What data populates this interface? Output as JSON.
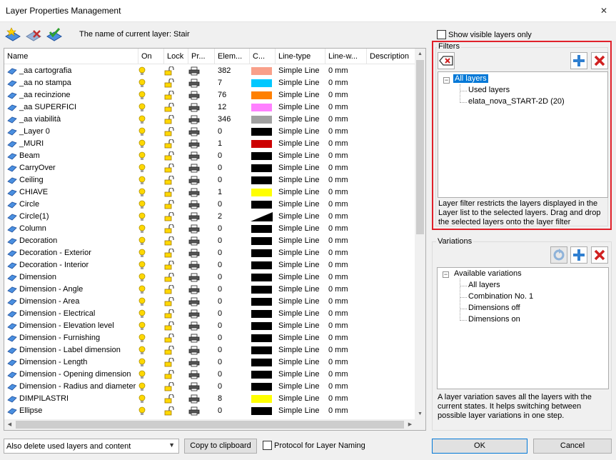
{
  "window": {
    "title": "Layer Properties Management",
    "close_label": "✕"
  },
  "current_layer_text": "The name of current layer: Stair",
  "show_visible_label": "Show visible layers only",
  "columns": [
    "Name",
    "On",
    "Lock",
    "Pr...",
    "Elem...",
    "C...",
    "Line-type",
    "Line-w...",
    "Description"
  ],
  "layers": [
    {
      "name": "_aa cartografia",
      "elements": "382",
      "color": "#f9a08a",
      "linetype": "Simple Line",
      "lineweight": "0 mm"
    },
    {
      "name": "_aa no stampa",
      "elements": "7",
      "color": "#00c8ff",
      "linetype": "Simple Line",
      "lineweight": "0 mm"
    },
    {
      "name": "_aa recinzione",
      "elements": "76",
      "color": "#ff8000",
      "linetype": "Simple Line",
      "lineweight": "0 mm"
    },
    {
      "name": "_aa SUPERFICI",
      "elements": "12",
      "color": "#ff80ff",
      "linetype": "Simple Line",
      "lineweight": "0 mm"
    },
    {
      "name": "_aa viabilità",
      "elements": "346",
      "color": "#a0a0a0",
      "linetype": "Simple Line",
      "lineweight": "0 mm"
    },
    {
      "name": "_Layer 0",
      "elements": "0",
      "color": "#000000",
      "linetype": "Simple Line",
      "lineweight": "0 mm"
    },
    {
      "name": "_MURI",
      "elements": "1",
      "color": "#cc0000",
      "linetype": "Simple Line",
      "lineweight": "0 mm"
    },
    {
      "name": "Beam",
      "elements": "0",
      "color": "#000000",
      "linetype": "Simple Line",
      "lineweight": "0 mm"
    },
    {
      "name": "CarryOver",
      "elements": "0",
      "color": "#000000",
      "linetype": "Simple Line",
      "lineweight": "0 mm"
    },
    {
      "name": "Ceiling",
      "elements": "0",
      "color": "#000000",
      "linetype": "Simple Line",
      "lineweight": "0 mm"
    },
    {
      "name": "CHIAVE",
      "elements": "1",
      "color": "#ffff00",
      "linetype": "Simple Line",
      "lineweight": "0 mm"
    },
    {
      "name": "Circle",
      "elements": "0",
      "color": "#000000",
      "linetype": "Simple Line",
      "lineweight": "0 mm"
    },
    {
      "name": "Circle(1)",
      "elements": "2",
      "color": "diag",
      "linetype": "Simple Line",
      "lineweight": "0 mm"
    },
    {
      "name": "Column",
      "elements": "0",
      "color": "#000000",
      "linetype": "Simple Line",
      "lineweight": "0 mm"
    },
    {
      "name": "Decoration",
      "elements": "0",
      "color": "#000000",
      "linetype": "Simple Line",
      "lineweight": "0 mm"
    },
    {
      "name": "Decoration - Exterior",
      "elements": "0",
      "color": "#000000",
      "linetype": "Simple Line",
      "lineweight": "0 mm"
    },
    {
      "name": "Decoration - Interior",
      "elements": "0",
      "color": "#000000",
      "linetype": "Simple Line",
      "lineweight": "0 mm"
    },
    {
      "name": "Dimension",
      "elements": "0",
      "color": "#000000",
      "linetype": "Simple Line",
      "lineweight": "0 mm"
    },
    {
      "name": "Dimension - Angle",
      "elements": "0",
      "color": "#000000",
      "linetype": "Simple Line",
      "lineweight": "0 mm"
    },
    {
      "name": "Dimension - Area",
      "elements": "0",
      "color": "#000000",
      "linetype": "Simple Line",
      "lineweight": "0 mm"
    },
    {
      "name": "Dimension - Electrical",
      "elements": "0",
      "color": "#000000",
      "linetype": "Simple Line",
      "lineweight": "0 mm"
    },
    {
      "name": "Dimension - Elevation level",
      "elements": "0",
      "color": "#000000",
      "linetype": "Simple Line",
      "lineweight": "0 mm"
    },
    {
      "name": "Dimension - Furnishing",
      "elements": "0",
      "color": "#000000",
      "linetype": "Simple Line",
      "lineweight": "0 mm"
    },
    {
      "name": "Dimension - Label dimension",
      "elements": "0",
      "color": "#000000",
      "linetype": "Simple Line",
      "lineweight": "0 mm"
    },
    {
      "name": "Dimension - Length",
      "elements": "0",
      "color": "#000000",
      "linetype": "Simple Line",
      "lineweight": "0 mm"
    },
    {
      "name": "Dimension - Opening dimension",
      "elements": "0",
      "color": "#000000",
      "linetype": "Simple Line",
      "lineweight": "0 mm"
    },
    {
      "name": "Dimension - Radius and diameter",
      "elements": "0",
      "color": "#000000",
      "linetype": "Simple Line",
      "lineweight": "0 mm"
    },
    {
      "name": "DIMPILASTRI",
      "elements": "8",
      "color": "#ffff00",
      "linetype": "Simple Line",
      "lineweight": "0 mm"
    },
    {
      "name": "Ellipse",
      "elements": "0",
      "color": "#000000",
      "linetype": "Simple Line",
      "lineweight": "0 mm"
    }
  ],
  "filters": {
    "label": "Filters",
    "root": "All layers",
    "children": [
      "Used layers",
      "elata_nova_START-2D (20)"
    ],
    "description": [
      "Layer filter restricts the layers displayed in the",
      "Layer list to the selected layers. Drag and drop",
      "the selected layers onto the layer filter"
    ]
  },
  "variations": {
    "label": "Variations",
    "root": "Available variations",
    "children": [
      "All layers",
      "Combination No. 1",
      "Dimensions off",
      "Dimensions on"
    ],
    "description": [
      "A layer variation saves all the layers with the",
      "current states. It helps switching between",
      "possible layer variations in one step."
    ]
  },
  "bottom": {
    "combo_value": "Also delete used layers and content",
    "copy_label": "Copy to clipboard",
    "protocol_label": "Protocol for Layer Naming",
    "ok_label": "OK",
    "cancel_label": "Cancel"
  }
}
